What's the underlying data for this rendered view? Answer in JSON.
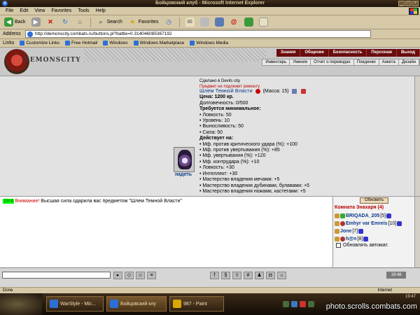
{
  "window": {
    "title": "Бойцовский клуб - Microsoft Internet Explorer",
    "buttons": [
      "_",
      "□",
      "×"
    ]
  },
  "menu": [
    "File",
    "Edit",
    "View",
    "Favorites",
    "Tools",
    "Help"
  ],
  "toolbar": {
    "back": "Back",
    "search": "Search",
    "favorites": "Favorites"
  },
  "address": {
    "label": "Address",
    "url": "http://demonscity.combats.ru/buttons.pl?battle=0.314046085367192"
  },
  "links": {
    "label": "Links",
    "items": [
      "Customize Links",
      "Free Hotmail",
      "Windows",
      "Windows Marketplace",
      "Windows Media"
    ]
  },
  "site": {
    "logo_text": "DEMONSCITY",
    "nav_top": [
      "Знания",
      "Общение",
      "Безопасность",
      "Персонаж",
      "Выход"
    ],
    "nav_sub": [
      "Инвентарь",
      "Умения",
      "Отчет о переводах",
      "Поединки",
      "Анкета",
      "Дизайн"
    ]
  },
  "prev_item": {
    "line1": "Сделано в Devils city",
    "line2": "Предмет не подлежит ремонту"
  },
  "item": {
    "name": "Шлем Темной Власти",
    "mass": "(Масса: 15)",
    "price": "Цена: 1200 кр.",
    "durability": "Долговечность: 0/500",
    "req_title": "Требуется минимальное:",
    "requirements": [
      "• Ловкость: 50",
      "• Уровень: 10",
      "• Выносливость: 50",
      "• Сила: 50"
    ],
    "effects_title": "Действует на:",
    "effects": [
      "• Мф. против критического удара (%): +100",
      "• Мф. против увертывания (%): +85",
      "• Мф. увертывания (%): +120",
      "• Мф. контрудара (%): +10",
      "• Ловкость: +30",
      "• Интеллект: +30",
      "• Мастерство владения мечами: +5",
      "• Мастерство владения дубинами, булавами: +5",
      "• Мастерство владения ножами, кастетами: +5"
    ],
    "wear_label": "надеть"
  },
  "chat": {
    "time": "19:4",
    "warning": "Внимание!",
    "message": "Высшая сила одарила вас предметом \"Шлем Темной Власти\""
  },
  "room": {
    "update_label": "Обновить",
    "title": "Комната Знахаря (4)",
    "users": [
      {
        "nick": "BRIQADA_205",
        "level": "[5]"
      },
      {
        "nick": "Emhyr var Emreis",
        "level": "[10]"
      },
      {
        "nick": "Jone",
        "level": "[7]"
      },
      {
        "nick": "h@n",
        "level": "[8]"
      }
    ],
    "auto_update_label": "Обновлять автомат."
  },
  "gamebar": {
    "clock": "19:48"
  },
  "status": {
    "left": "Done",
    "zone": "Internet"
  },
  "taskbar": {
    "tasks": [
      "WarStyle - Mic...",
      "Бойцовский клу",
      "987 - Paint"
    ],
    "clock": "19:47"
  },
  "watermark": "photo.scrolls.combats.com",
  "colors": {
    "chrome": "#d6c9a8",
    "site_nav": "#6b0d0d",
    "link_blue": "#0b3a8a",
    "warning_red": "#cc0000",
    "time_green": "#00ff00"
  }
}
